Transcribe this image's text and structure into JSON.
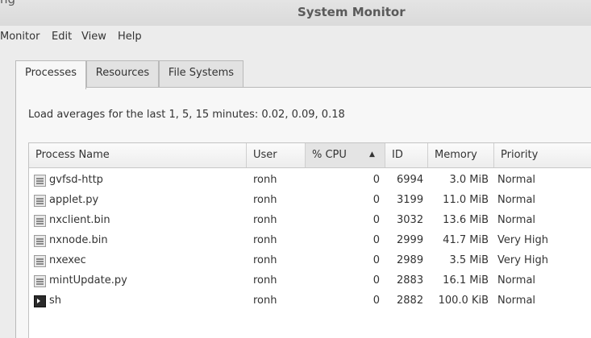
{
  "window": {
    "title": "System Monitor",
    "title_fragment": "ng"
  },
  "menubar": {
    "items": [
      "Monitor",
      "Edit",
      "View",
      "Help"
    ]
  },
  "tabs": [
    {
      "label": "Processes",
      "active": true
    },
    {
      "label": "Resources",
      "active": false
    },
    {
      "label": "File Systems",
      "active": false
    }
  ],
  "load_averages": "Load averages for the last 1, 5, 15 minutes: 0.02, 0.09, 0.18",
  "table": {
    "columns": [
      "Process Name",
      "User",
      "% CPU",
      "ID",
      "Memory",
      "Priority"
    ],
    "sort_column": "% CPU",
    "sort_direction": "ascending",
    "sort_indicator": "▲",
    "rows": [
      {
        "name": "gvfsd-http",
        "user": "ronh",
        "cpu": "0",
        "id": "6994",
        "memory": "3.0 MiB",
        "priority": "Normal",
        "icon": "process-icon"
      },
      {
        "name": "applet.py",
        "user": "ronh",
        "cpu": "0",
        "id": "3199",
        "memory": "11.0 MiB",
        "priority": "Normal",
        "icon": "process-icon"
      },
      {
        "name": "nxclient.bin",
        "user": "ronh",
        "cpu": "0",
        "id": "3032",
        "memory": "13.6 MiB",
        "priority": "Normal",
        "icon": "process-icon"
      },
      {
        "name": "nxnode.bin",
        "user": "ronh",
        "cpu": "0",
        "id": "2999",
        "memory": "41.7 MiB",
        "priority": "Very High",
        "icon": "process-icon"
      },
      {
        "name": "nxexec",
        "user": "ronh",
        "cpu": "0",
        "id": "2989",
        "memory": "3.5 MiB",
        "priority": "Very High",
        "icon": "process-icon"
      },
      {
        "name": "mintUpdate.py",
        "user": "ronh",
        "cpu": "0",
        "id": "2883",
        "memory": "16.1 MiB",
        "priority": "Normal",
        "icon": "process-icon"
      },
      {
        "name": "sh",
        "user": "ronh",
        "cpu": "0",
        "id": "2882",
        "memory": "100.0 KiB",
        "priority": "Normal",
        "icon": "terminal-icon"
      }
    ]
  }
}
